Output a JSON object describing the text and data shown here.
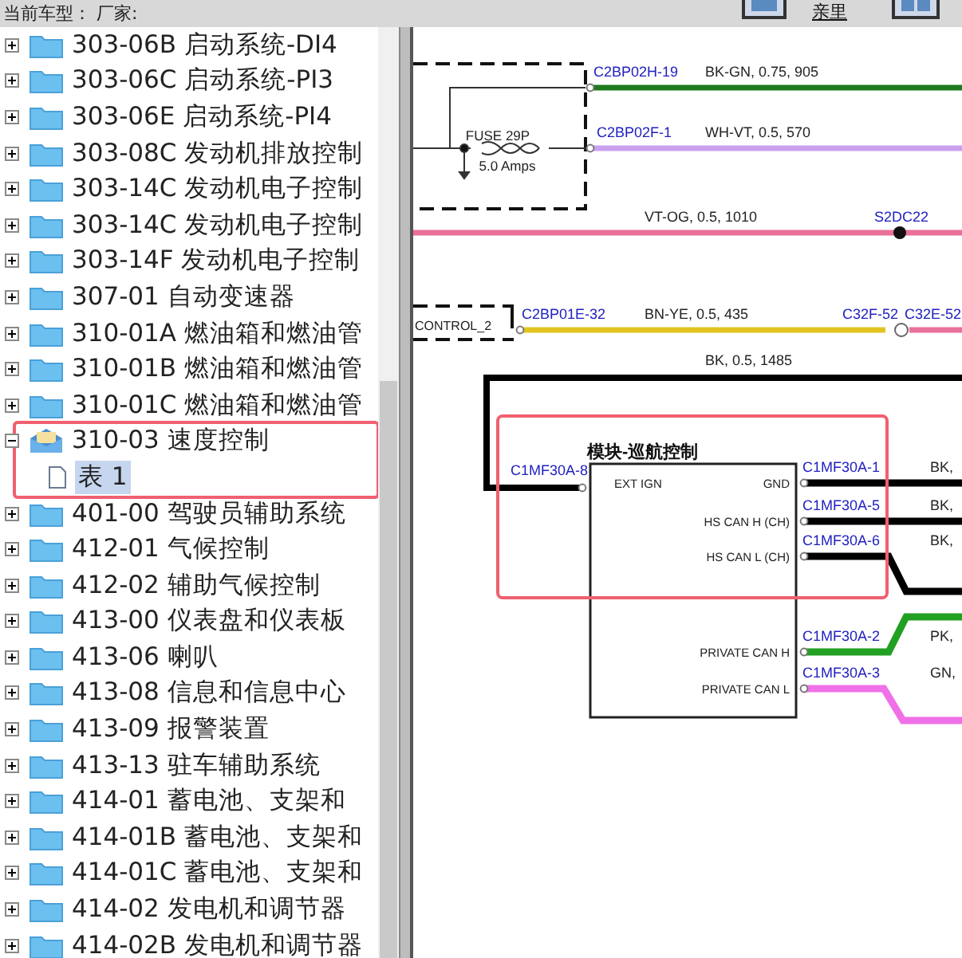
{
  "top_bar": {
    "vehicle_text": "当前车型： 厂家:",
    "toolbar_label": "亲里"
  },
  "tree": [
    {
      "label": "303-06B 启动系统-DI4",
      "expanded": false
    },
    {
      "label": "303-06C 启动系统-PI3",
      "expanded": false
    },
    {
      "label": "303-06E 启动系统-PI4",
      "expanded": false
    },
    {
      "label": "303-08C 发动机排放控制",
      "expanded": false
    },
    {
      "label": "303-14C 发动机电子控制",
      "expanded": false
    },
    {
      "label": "303-14C 发动机电子控制",
      "expanded": false
    },
    {
      "label": "303-14F 发动机电子控制",
      "expanded": false
    },
    {
      "label": "307-01 自动变速器",
      "expanded": false
    },
    {
      "label": "310-01A 燃油箱和燃油管",
      "expanded": false
    },
    {
      "label": "310-01B 燃油箱和燃油管",
      "expanded": false
    },
    {
      "label": "310-01C 燃油箱和燃油管",
      "expanded": false
    },
    {
      "label": "310-03 速度控制",
      "expanded": true,
      "highlighted": true,
      "children": [
        {
          "label": "表 1",
          "selected": true
        }
      ]
    },
    {
      "label": "401-00 驾驶员辅助系统",
      "expanded": false
    },
    {
      "label": "412-01 气候控制",
      "expanded": false
    },
    {
      "label": "412-02 辅助气候控制",
      "expanded": false
    },
    {
      "label": "413-00 仪表盘和仪表板",
      "expanded": false
    },
    {
      "label": "413-06 喇叭",
      "expanded": false
    },
    {
      "label": "413-08 信息和信息中心",
      "expanded": false
    },
    {
      "label": "413-09 报警装置",
      "expanded": false
    },
    {
      "label": "413-13 驻车辅助系统",
      "expanded": false
    },
    {
      "label": "414-01 蓄电池、支架和",
      "expanded": false
    },
    {
      "label": "414-01B 蓄电池、支架和",
      "expanded": false
    },
    {
      "label": "414-01C 蓄电池、支架和",
      "expanded": false
    },
    {
      "label": "414-02 发电机和调节器",
      "expanded": false
    },
    {
      "label": "414-02B 发电机和调节器",
      "expanded": false
    }
  ],
  "diagram": {
    "fuse": {
      "name": "FUSE 29P",
      "rating": "5.0 Amps"
    },
    "control_box": "CONTROL_2",
    "wires": [
      {
        "connector": "C2BP02H-19",
        "spec": "BK-GN, 0.75, 905",
        "color": "#1d7a1d"
      },
      {
        "connector": "C2BP02F-1",
        "spec": "WH-VT, 0.5, 570",
        "color": "#c8a0ee"
      },
      {
        "connector": "S2DC22",
        "spec": "VT-OG, 0.5, 1010",
        "color": "#e8709a"
      },
      {
        "connector": "C2BP01E-32",
        "spec": "BN-YE, 0.5, 435",
        "color": "#e2c420",
        "end_connector": "C32F-52"
      },
      {
        "connector": "C32E-52",
        "color": "#e8709a"
      },
      {
        "connector": "C1MF30A-8",
        "spec": "BK, 0.5, 1485",
        "color": "#000000"
      }
    ],
    "module": {
      "title": "模块-巡航控制",
      "highlighted": true,
      "left_pins": [
        {
          "label": "EXT IGN"
        }
      ],
      "right_pins": [
        {
          "label": "GND",
          "connector": "C1MF30A-1",
          "spec": "BK,",
          "color": "#000000"
        },
        {
          "label": "HS CAN H (CH)",
          "connector": "C1MF30A-5",
          "spec": "BK,",
          "color": "#000000"
        },
        {
          "label": "HS CAN L (CH)",
          "connector": "C1MF30A-6",
          "spec": "BK,",
          "color": "#000000"
        },
        {
          "label": "PRIVATE CAN H",
          "connector": "C1MF30A-2",
          "spec": "PK,",
          "color": "#22a022"
        },
        {
          "label": "PRIVATE CAN L",
          "connector": "C1MF30A-3",
          "spec": "GN,",
          "color": "#f070e8"
        }
      ]
    }
  }
}
